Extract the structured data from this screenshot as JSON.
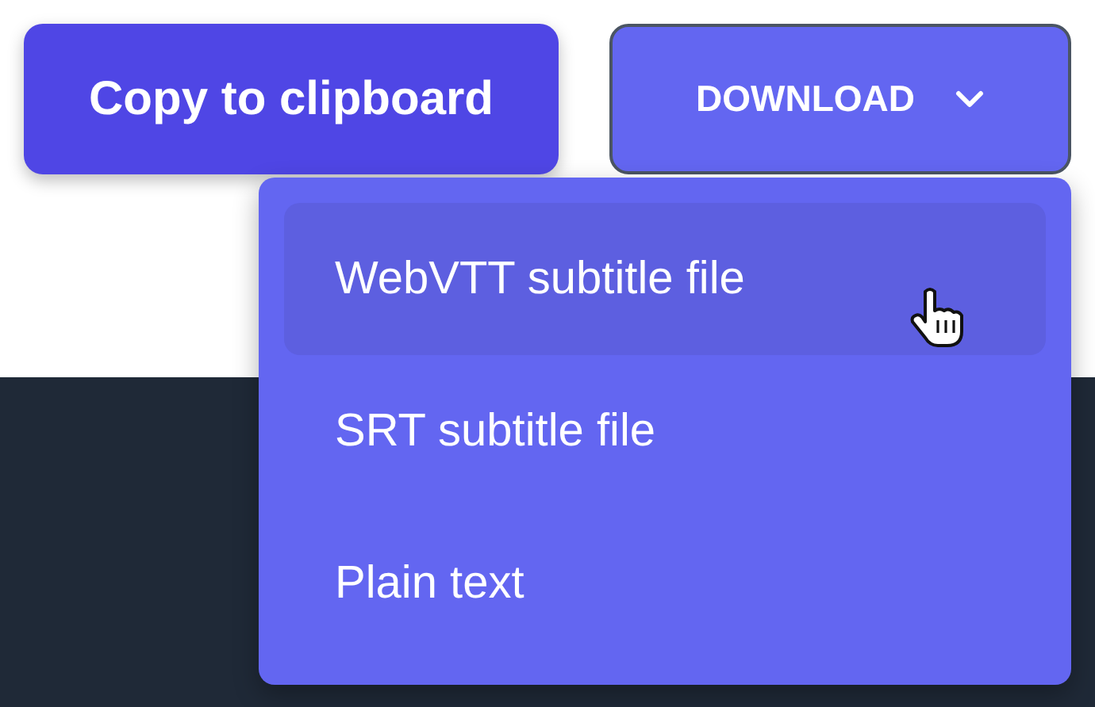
{
  "copy_button": {
    "label": "Copy to clipboard"
  },
  "download": {
    "label": "DOWNLOAD",
    "expanded": true,
    "menu": [
      {
        "label": "WebVTT subtitle file",
        "selected": true
      },
      {
        "label": "SRT subtitle file",
        "selected": false
      },
      {
        "label": "Plain text",
        "selected": false
      }
    ]
  }
}
